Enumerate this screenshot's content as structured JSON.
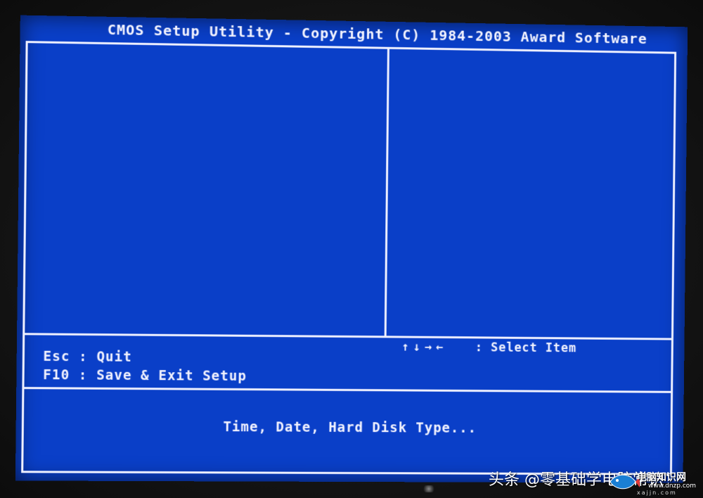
{
  "bios": {
    "title": "CMOS Setup Utility - Copyright (C) 1984-2003 Award Software",
    "keys": {
      "esc": "Esc : Quit",
      "f10": "F10 : Save & Exit Setup",
      "arrows": "↑↓→←",
      "select_item": ": Select Item"
    },
    "status_line": "Time, Date, Hard Disk Type...",
    "colors": {
      "background": "#0a3fc8",
      "foreground": "#f4f4ff"
    }
  },
  "watermark": {
    "text": "头条 @零基础学电脑常识",
    "brand": "电脑知识网",
    "url": "www.dnzp.com",
    "url2": "xajjn.com"
  }
}
